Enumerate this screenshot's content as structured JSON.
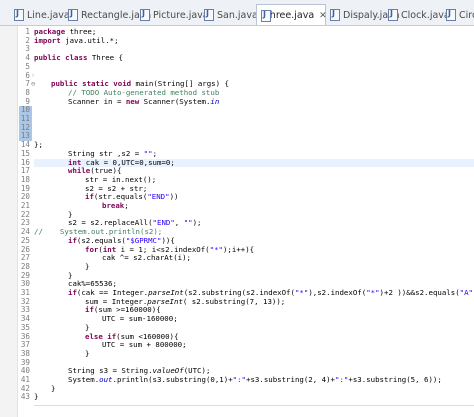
{
  "tabs": [
    {
      "label": "Line.java",
      "active": false
    },
    {
      "label": "Rectangle.java",
      "active": false
    },
    {
      "label": "Picture.java",
      "active": false
    },
    {
      "label": "San.java",
      "active": false
    },
    {
      "label": "Three.java",
      "active": true
    },
    {
      "label": "Dispaly.java",
      "active": false
    },
    {
      "label": "Clock.java",
      "active": false
    },
    {
      "label": "Circle",
      "active": false
    }
  ],
  "close_glyph": "✕",
  "annotations": {
    "line6": "◦",
    "line7": "⊖"
  },
  "lines": [
    {
      "n": "1"
    },
    {
      "n": "2"
    },
    {
      "n": "3"
    },
    {
      "n": "4"
    },
    {
      "n": "5"
    },
    {
      "n": "6"
    },
    {
      "n": "7"
    },
    {
      "n": "8"
    },
    {
      "n": "9"
    },
    {
      "n": "10"
    },
    {
      "n": "11"
    },
    {
      "n": "12"
    },
    {
      "n": "13"
    },
    {
      "n": "14"
    },
    {
      "n": "15"
    },
    {
      "n": "16"
    },
    {
      "n": "17"
    },
    {
      "n": "18"
    },
    {
      "n": "19"
    },
    {
      "n": "20"
    },
    {
      "n": "21"
    },
    {
      "n": "22"
    },
    {
      "n": "23"
    },
    {
      "n": "24"
    },
    {
      "n": "25"
    },
    {
      "n": "26"
    },
    {
      "n": "27"
    },
    {
      "n": "28"
    },
    {
      "n": "29"
    },
    {
      "n": "30"
    },
    {
      "n": "31"
    },
    {
      "n": "32"
    },
    {
      "n": "33"
    },
    {
      "n": "34"
    },
    {
      "n": "35"
    },
    {
      "n": "36"
    },
    {
      "n": "37"
    },
    {
      "n": "38"
    },
    {
      "n": "39"
    },
    {
      "n": "40"
    },
    {
      "n": "41"
    },
    {
      "n": "42"
    },
    {
      "n": "43"
    }
  ],
  "code": {
    "l1_kw": "package",
    "l1_rest": " three;",
    "l2_kw": "import",
    "l2_rest": " java.util.*;",
    "l4_kw": "public class",
    "l4_rest": " Three {",
    "l7_kw": "public static void",
    "l7_rest": " main(String[] args) {",
    "l8_cmt": "// TODO Auto-generated method stub",
    "l9_a": "Scanner in = ",
    "l9_kw": "new",
    "l9_b": " Scanner(System.",
    "l9_fld": "in",
    "l14": "};",
    "l15_a": "String str ,s2 = ",
    "l15_str": "\"\"",
    "l15_b": ";",
    "l16_kw": "int",
    "l16_rest": " cak = 0,UTC=0,sum=0;",
    "l17_kw": "while",
    "l17_rest": "(true){",
    "l18": "str = in.next();",
    "l19": "s2 = s2 + str;",
    "l20_kw": "if",
    "l20_a": "(str.equals(",
    "l20_str": "\"END\"",
    "l20_b": "))",
    "l21_kw": "break",
    "l21_rest": ";",
    "l22": "}",
    "l23_a": "s2 = s2.replaceAll(",
    "l23_s1": "\"END\"",
    "l23_b": ", ",
    "l23_s2": "\"\"",
    "l23_c": ");",
    "l24_cmt": "//",
    "l24_rest": "System.out.println(s2);",
    "l25_kw": "if",
    "l25_a": "(s2.equals(",
    "l25_str": "\"$GPRMC\"",
    "l25_b": ")){",
    "l26_kw1": "for",
    "l26_a": "(",
    "l26_kw2": "int",
    "l26_b": " i = 1; i<s2.indexOf(",
    "l26_str": "\"*\"",
    "l26_c": ");i++){",
    "l27": "cak ^= s2.charAt(i);",
    "l28": "}",
    "l29": "}",
    "l30": "cak%=65536;",
    "l31_kw": "if",
    "l31_a": "(cak == Integer.",
    "l31_it": "parseInt",
    "l31_b": "(s2.substring(s2.indexOf(",
    "l31_s1": "\"*\"",
    "l31_c": "),s2.indexOf(",
    "l31_s2": "\"*\"",
    "l31_d": ")+2 ))&&s2.equals(",
    "l31_s3": "\"A\"",
    "l31_e": ")){",
    "l32_a": "sum = Integer.",
    "l32_it": "parseInt",
    "l32_b": "( s2.substring(7, 13));",
    "l33_kw": "if",
    "l33_rest": "(sum >=160000){",
    "l34": "UTC = sum-160000;",
    "l35": "}",
    "l36_kw": "else if",
    "l36_rest": "(sum <160000){",
    "l37": "UTC = sum + 800000;",
    "l38": "}",
    "l40_a": "String s3 = String.",
    "l40_it": "valueOf",
    "l40_b": "(UTC);",
    "l41_a": "System.",
    "l41_fld": "out",
    "l41_b": ".println(s3.substring(0,1)+",
    "l41_s1": "\":\"",
    "l41_c": "+s3.substring(2, 4)+",
    "l41_s2": "\":\"",
    "l41_d": "+s3.substring(5, 6));",
    "l42": "}",
    "l43": "}"
  }
}
